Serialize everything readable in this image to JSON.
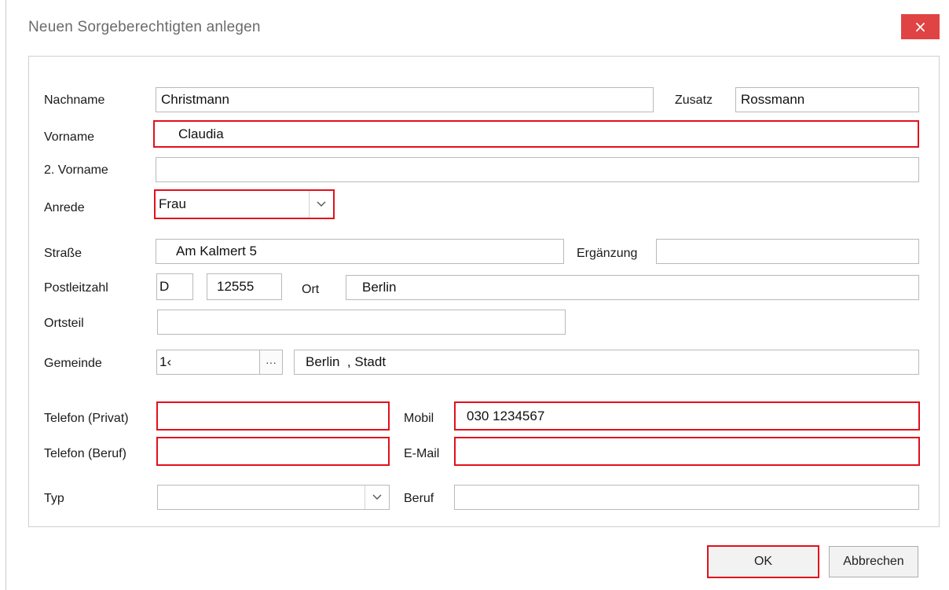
{
  "window": {
    "title": "Neuen Sorgeberechtigten anlegen",
    "close_glyph": "×",
    "accent_close": "#e04343",
    "required_border_color": "#e2101b"
  },
  "form": {
    "nachname": {
      "label": "Nachname",
      "value": "Christmann"
    },
    "zusatz": {
      "label": "Zusatz",
      "value": "Rossmann"
    },
    "vorname": {
      "label": "Vorname",
      "value": "Claudia"
    },
    "vorname2": {
      "label": "2. Vorname",
      "value": ""
    },
    "anrede": {
      "label": "Anrede",
      "value": "Frau"
    },
    "strasse": {
      "label": "Straße",
      "value": "Am Kalmert 5"
    },
    "ergaenzung": {
      "label": "Ergänzung",
      "value": ""
    },
    "postleitzahl": {
      "label": "Postleitzahl",
      "country": "D",
      "value": "12555"
    },
    "ort": {
      "label": "Ort",
      "value": "Berlin"
    },
    "ortsteil": {
      "label": "Ortsteil",
      "value": ""
    },
    "gemeinde": {
      "label": "Gemeinde",
      "code": "1‹",
      "dots": "···",
      "value": "Berlin  , Stadt"
    },
    "telefon_privat": {
      "label": "Telefon (Privat)",
      "value": ""
    },
    "mobil": {
      "label": "Mobil",
      "value": "030 1234567"
    },
    "telefon_beruf": {
      "label": "Telefon (Beruf)",
      "value": ""
    },
    "email": {
      "label": "E-Mail",
      "value": ""
    },
    "typ": {
      "label": "Typ",
      "value": ""
    },
    "beruf": {
      "label": "Beruf",
      "value": ""
    }
  },
  "buttons": {
    "ok": "OK",
    "cancel": "Abbrechen"
  }
}
